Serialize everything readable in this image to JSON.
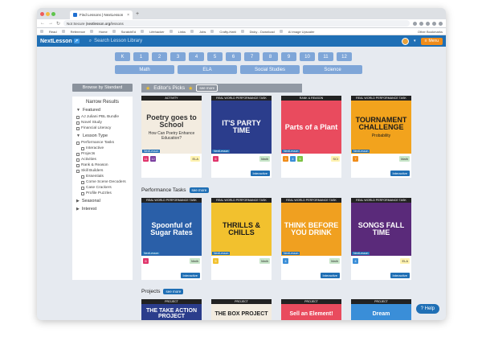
{
  "browser": {
    "tab_title": "Find Lessons | NextLesson",
    "url_prefix": "Not Secure | ",
    "url_domain": "nextlesson.org",
    "url_path": "/lessons",
    "bookmarks": [
      "Read",
      "Reference",
      "Home",
      "ScratchEd",
      "Lifehacker",
      "Links",
      "Jobs",
      "Crafty-Hatti",
      "Dicky - Download",
      "AI image Upscaler"
    ],
    "other_bookmarks": "Other Bookmarks"
  },
  "nav": {
    "logo": "NextLesson",
    "search_placeholder": "Search Lesson Library",
    "menu_label": "Menu"
  },
  "grades": [
    "K",
    "1",
    "2",
    "3",
    "4",
    "5",
    "6",
    "7",
    "8",
    "9",
    "10",
    "11",
    "12"
  ],
  "subjects": [
    "Math",
    "ELA",
    "Social Studies",
    "Science"
  ],
  "sidebar": {
    "browse_label": "Browse by Standard",
    "title": "Narrow Results",
    "featured_label": "Featured",
    "featured": [
      "AJ Juliani PBL Bundle",
      "Novel Study",
      "Financial Literacy"
    ],
    "lesson_type_label": "Lesson Type",
    "lesson_types": [
      {
        "label": "Performance Tasks",
        "level": 0
      },
      {
        "label": "Interactive",
        "level": 1
      },
      {
        "label": "Projects",
        "level": 0
      },
      {
        "label": "Activities",
        "level": 0
      },
      {
        "label": "Rank & Reason",
        "level": 0
      },
      {
        "label": "Skill Builders",
        "level": 0
      },
      {
        "label": "Essentials",
        "level": 1
      },
      {
        "label": "Come Scene Decoders",
        "level": 1
      },
      {
        "label": "Case Crackers",
        "level": 1
      },
      {
        "label": "Profile Puzzles",
        "level": 1
      }
    ],
    "seasonal_label": "Seasonal",
    "interest_label": "Interest"
  },
  "editors_picks": {
    "title": "Editor's Picks",
    "see_more": "see more",
    "cards": [
      {
        "type": "ACTIVITY",
        "title": "Poetry goes to School",
        "subtitle": "How Can Poetry Enhance Education?",
        "bg": "#f3ece0",
        "fg": "#333333",
        "grades": [
          "11",
          "12"
        ],
        "grade_colors": [
          "#e0356c",
          "#7b3fa0"
        ],
        "subject": "ELA",
        "subject_color": "#fff3b0",
        "interactive": ""
      },
      {
        "type": "REAL WORLD PERFORMANCE TASK",
        "title": "IT'S PARTY TIME",
        "subtitle": "",
        "bg": "#2b3d8c",
        "fg": "#ffffff",
        "grades": [
          "6"
        ],
        "grade_colors": [
          "#e0356c"
        ],
        "subject": "Math",
        "subject_color": "#c8e6c9",
        "interactive": "Interactive"
      },
      {
        "type": "RANK & REASON",
        "title": "Parts of a Plant",
        "subtitle": "",
        "bg": "#e94b5e",
        "fg": "#ffffff",
        "grades": [
          "3",
          "4",
          "5"
        ],
        "grade_colors": [
          "#f08c1a",
          "#3a8ed8",
          "#7cc242"
        ],
        "subject": "SCI",
        "subject_color": "#fff3b0",
        "interactive": ""
      },
      {
        "type": "REAL WORLD PERFORMANCE TASK",
        "title": "TOURNAMENT CHALLENGE",
        "subtitle": "Probability",
        "bg": "#f2a31d",
        "fg": "#1a1a1a",
        "grades": [
          "7"
        ],
        "grade_colors": [
          "#f08c1a"
        ],
        "subject": "Math",
        "subject_color": "#c8e6c9",
        "interactive": "Interactive"
      }
    ]
  },
  "performance_tasks": {
    "title": "Performance Tasks",
    "see_more": "see more",
    "cards": [
      {
        "type": "REAL WORLD PERFORMANCE TASK",
        "title": "Spoonful of Sugar Rates",
        "subtitle": "",
        "bg": "#2a5fa8",
        "fg": "#ffffff",
        "grades": [
          "6"
        ],
        "grade_colors": [
          "#e0356c"
        ],
        "subject": "Math",
        "subject_color": "#c8e6c9",
        "interactive": "Interactive"
      },
      {
        "type": "REAL WORLD PERFORMANCE TASK",
        "title": "THRILLS & CHILLS",
        "subtitle": "",
        "bg": "#f2c12e",
        "fg": "#1a1a1a",
        "grades": [
          "5"
        ],
        "grade_colors": [
          "#f2c12e"
        ],
        "subject": "Math",
        "subject_color": "#c8e6c9",
        "interactive": ""
      },
      {
        "type": "REAL WORLD PERFORMANCE TASK",
        "title": "THINK BEFORE YOU DRINK",
        "subtitle": "",
        "bg": "#f0a020",
        "fg": "#ffffff",
        "grades": [
          "4"
        ],
        "grade_colors": [
          "#3a8ed8"
        ],
        "subject": "Math",
        "subject_color": "#c8e6c9",
        "interactive": "Interactive"
      },
      {
        "type": "REAL WORLD PERFORMANCE TASK",
        "title": "SONGS FALL TIME",
        "subtitle": "",
        "bg": "#5a2a7a",
        "fg": "#ffffff",
        "grades": [
          "4"
        ],
        "grade_colors": [
          "#3a8ed8"
        ],
        "subject": "ELA",
        "subject_color": "#fff3b0",
        "interactive": "Interactive"
      }
    ]
  },
  "projects": {
    "title": "Projects",
    "see_more": "see more",
    "cards": [
      {
        "type": "PROJECT",
        "title": "THE TAKE ACTION PROJECT",
        "bg": "#2b3d8c",
        "fg": "#ffffff"
      },
      {
        "type": "PROJECT",
        "title": "THE BOX PROJECT",
        "bg": "#f3ece0",
        "fg": "#222222"
      },
      {
        "type": "PROJECT",
        "title": "Sell an Element!",
        "bg": "#e94b5e",
        "fg": "#ffffff"
      },
      {
        "type": "PROJECT",
        "title": "Dream",
        "bg": "#3a8ed8",
        "fg": "#ffffff"
      }
    ]
  },
  "help_label": "Help"
}
